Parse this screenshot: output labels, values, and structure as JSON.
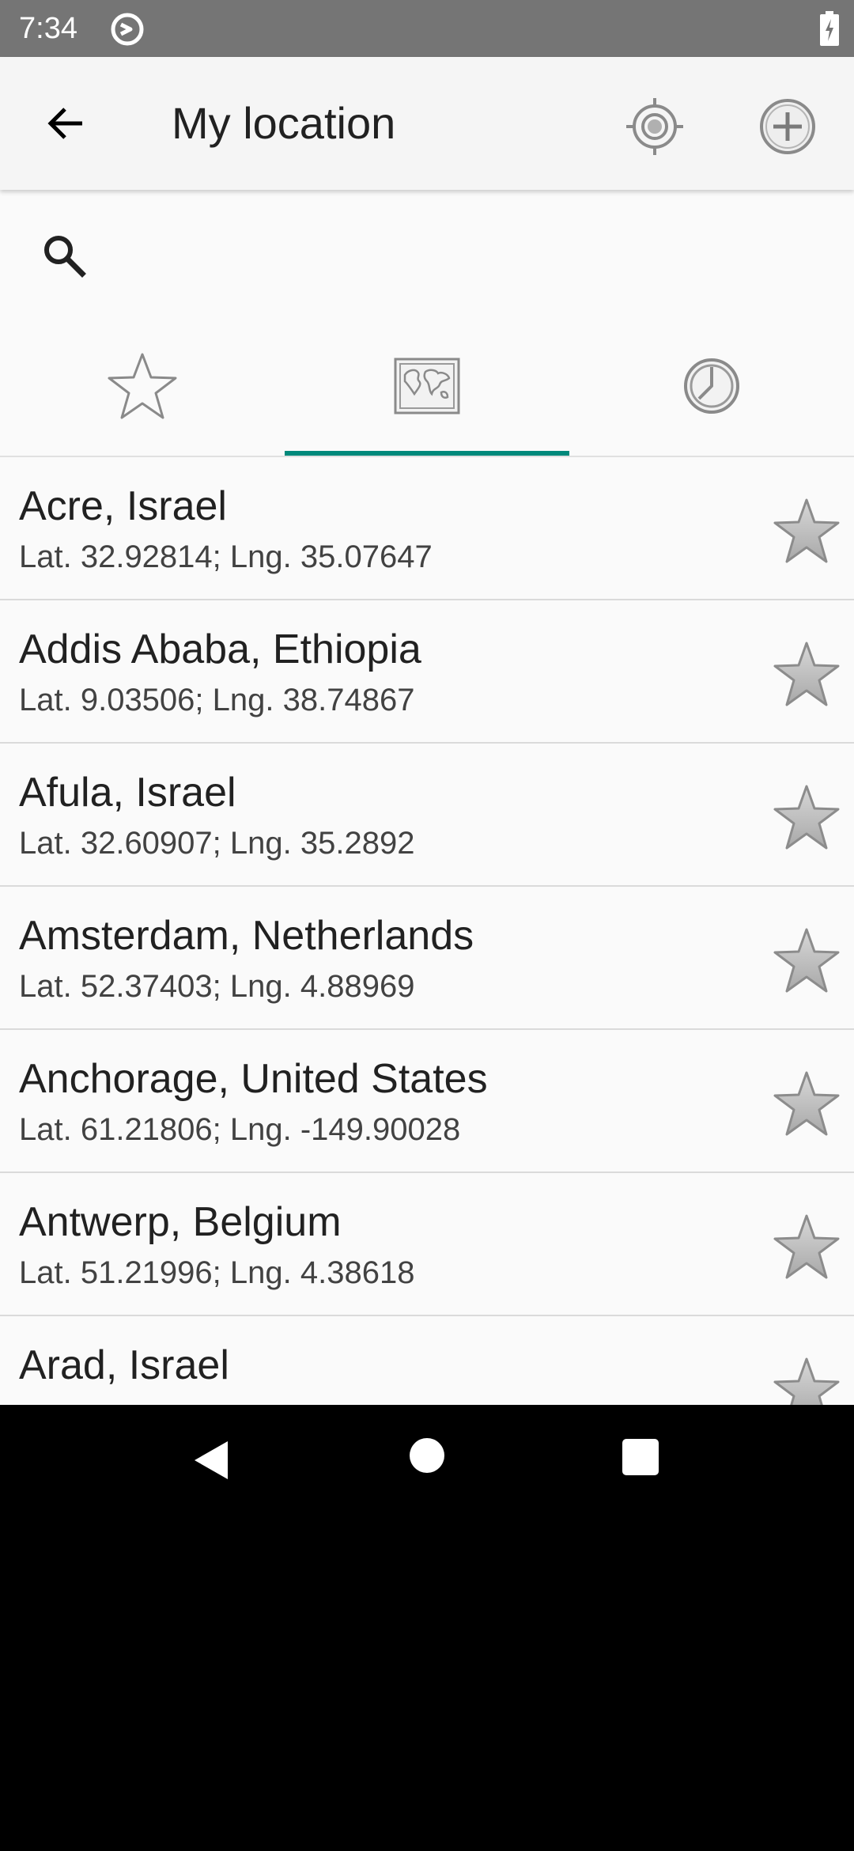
{
  "status_bar": {
    "time": "7:34",
    "sync_icon": "sync-circle-icon",
    "battery_icon": "battery-charging-icon"
  },
  "app_bar": {
    "title": "My location",
    "back_icon": "arrow-back-icon",
    "locate_icon": "crosshair-icon",
    "add_icon": "add-circle-icon"
  },
  "search": {
    "icon": "search-icon",
    "value": "",
    "placeholder": ""
  },
  "tabs": [
    {
      "icon": "star-outline-icon",
      "selected": false
    },
    {
      "icon": "world-map-icon",
      "selected": true
    },
    {
      "icon": "clock-icon",
      "selected": false
    }
  ],
  "locations": [
    {
      "name": "Acre, Israel",
      "coords": "Lat. 32.92814; Lng. 35.07647"
    },
    {
      "name": "Addis Ababa, Ethiopia",
      "coords": "Lat. 9.03506; Lng. 38.74867"
    },
    {
      "name": "Afula, Israel",
      "coords": "Lat. 32.60907; Lng. 35.2892"
    },
    {
      "name": "Amsterdam, Netherlands",
      "coords": "Lat. 52.37403; Lng. 4.88969"
    },
    {
      "name": "Anchorage, United States",
      "coords": "Lat. 61.21806; Lng. -149.90028"
    },
    {
      "name": "Antwerp, Belgium",
      "coords": "Lat. 51.21996; Lng. 4.38618"
    },
    {
      "name": "Arad, Israel",
      "coords": ""
    }
  ],
  "colors": {
    "accent": "#00897b",
    "status_bar": "#757575",
    "app_bar": "#f5f5f5",
    "background": "#fafafa"
  }
}
